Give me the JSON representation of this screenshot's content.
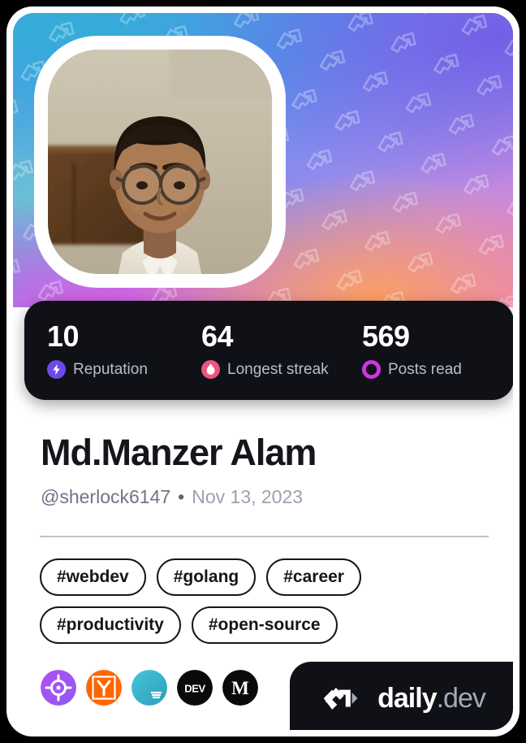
{
  "card": {
    "type": "devcard",
    "background": "#ffffff"
  },
  "cover": {
    "pattern_icon": "daily-dev-chevron-watermark",
    "gradient_colors": [
      "#46a6e8",
      "#5b8ef0",
      "#8f8bec",
      "#c489e0",
      "#e87fd0",
      "#ffa05a"
    ]
  },
  "avatar": {
    "icon": "user-avatar-photo",
    "alt": "Md.Manzer Alam profile photo"
  },
  "stats": [
    {
      "value": "10",
      "label": "Reputation",
      "icon": "reputation-bolt-icon",
      "color": "#6c4ae8"
    },
    {
      "value": "64",
      "label": "Longest streak",
      "icon": "streak-flame-icon",
      "color": "#f0527e"
    },
    {
      "value": "569",
      "label": "Posts read",
      "icon": "posts-read-ring-icon",
      "color": "#cf35e1"
    }
  ],
  "profile": {
    "name": "Md.Manzer Alam",
    "handle": "@sherlock6147",
    "separator": "•",
    "joined": "Nov 13, 2023"
  },
  "tags": [
    "#webdev",
    "#golang",
    "#career",
    "#productivity",
    "#open-source"
  ],
  "sources": [
    {
      "name": "daily-dev-source-icon",
      "color": "#a855f7"
    },
    {
      "name": "hacker-news-source-icon",
      "color": "#ff6600"
    },
    {
      "name": "hashnode-source-icon",
      "color": "#3ab3cc"
    },
    {
      "name": "dev-to-source-icon",
      "color": "#0a0a0a"
    },
    {
      "name": "medium-source-icon",
      "color": "#0a0a0a"
    }
  ],
  "brand": {
    "logo_icon": "daily-dev-logo",
    "name": "daily",
    "suffix": ".dev",
    "background": "#0f1117"
  }
}
